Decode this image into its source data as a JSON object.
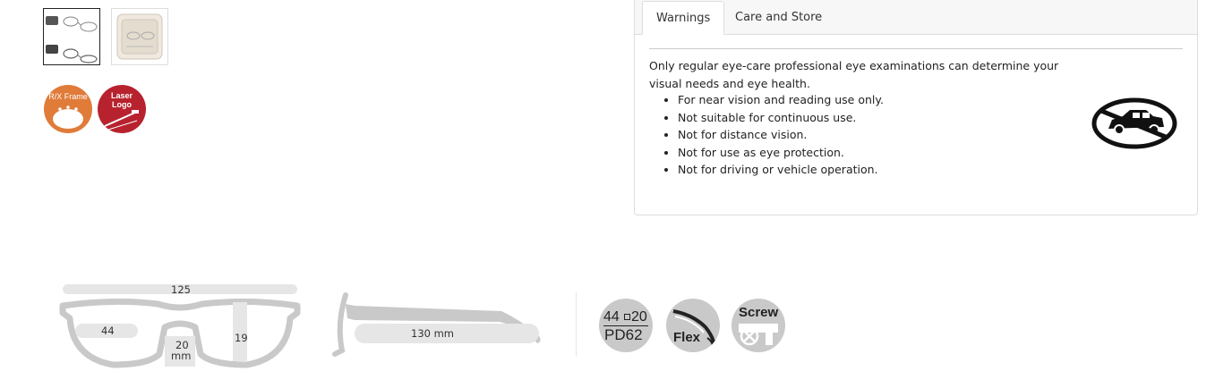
{
  "tabs": {
    "warnings": "Warnings",
    "care": "Care and Store"
  },
  "warnings": {
    "intro": "Only regular eye-care professional eye examinations can determine your visual needs and eye health.",
    "items": [
      "For near vision and reading use only.",
      "Not suitable for continuous use.",
      "Not for distance vision.",
      "Not for use as eye protection.",
      "Not for driving or vehicle operation."
    ]
  },
  "badges": {
    "rx": "R/X Frame",
    "laser_line1": "Laser",
    "laser_line2": "Logo"
  },
  "measurements": {
    "frame_width": "125",
    "lens_width": "44",
    "bridge_value": "20",
    "bridge_unit": "mm",
    "lens_height": "19",
    "temple": "130 mm"
  },
  "features": {
    "size_top_left": "44",
    "size_top_right": "20",
    "size_pd": "PD62",
    "flex": "Flex",
    "screw": "Screw"
  }
}
